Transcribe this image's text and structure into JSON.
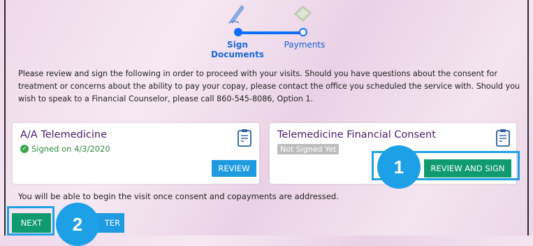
{
  "stepper": {
    "step1_label_line1": "Sign",
    "step1_label_line2": "Documents",
    "step2_label": "Payments"
  },
  "intro": "Please review and sign the following in order to proceed with your visits. Should you have questions about the consent for treatment or concerns about the ability to pay your copay, please contact the office you scheduled the service with. Should you wish to speak to a Financial Counselor, please call 860-545-8086, Option 1.",
  "cards": [
    {
      "title": "A/A Telemedicine",
      "status": "Signed on 4/3/2020",
      "button": "REVIEW"
    },
    {
      "title": "Telemedicine Financial Consent",
      "status": "Not Signed Yet",
      "button": "REVIEW AND SIGN"
    }
  ],
  "note": "You will be able to begin the visit once consent and copayments are addressed.",
  "footer": {
    "next_label": "NEXT",
    "partial_label": "TER"
  },
  "callouts": {
    "one": "1",
    "two": "2"
  },
  "colors": {
    "accent_blue": "#1ea0e6",
    "green_button": "#0f9b6e",
    "title_purple": "#4a1d6b",
    "signed_green": "#2e8b3e"
  }
}
